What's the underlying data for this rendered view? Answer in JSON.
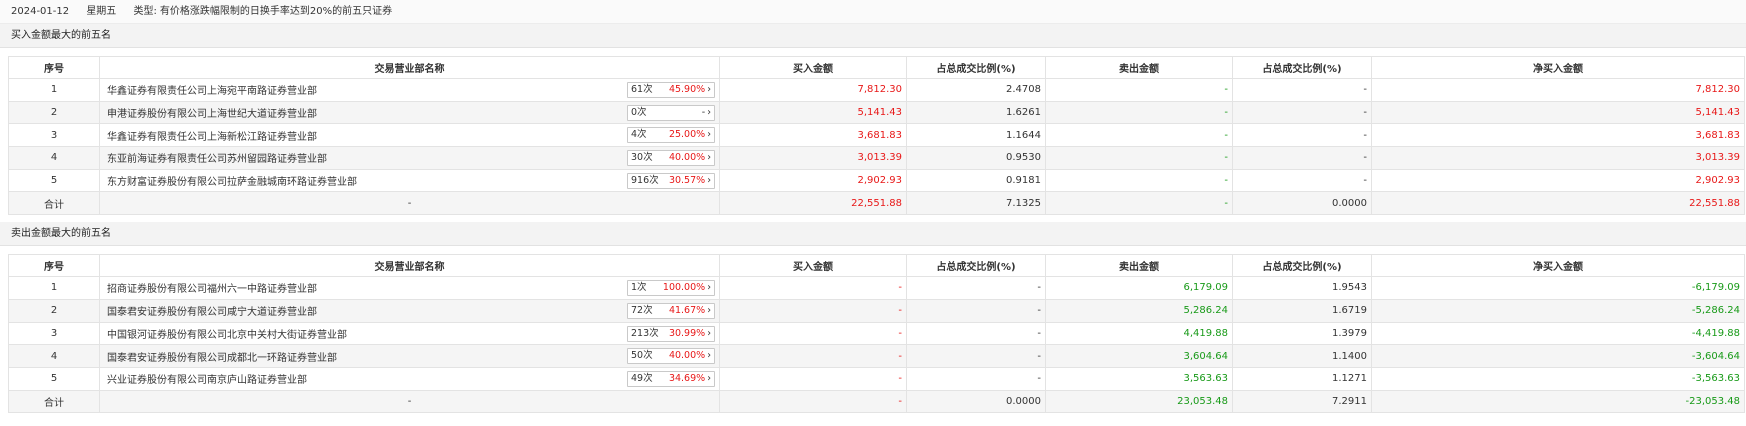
{
  "header": {
    "date": "2024-01-12",
    "weekday": "星期五",
    "type_label": "类型:",
    "type_value": "有价格涨跌幅限制的日换手率达到20%的前五只证券"
  },
  "columns": [
    "序号",
    "交易营业部名称",
    "买入金额",
    "占总成交比例(%)",
    "卖出金额",
    "占总成交比例(%)",
    "净买入金额"
  ],
  "buy_section": {
    "title": "买入金额最大的前五名",
    "rows": [
      {
        "idx": "1",
        "name": "华鑫证券有限责任公司上海宛平南路证券营业部",
        "count": "61次",
        "pct": "45.90%",
        "buy": "7,812.30",
        "buy_ratio": "2.4708",
        "sell": "-",
        "sell_ratio": "-",
        "net": "7,812.30"
      },
      {
        "idx": "2",
        "name": "申港证券股份有限公司上海世纪大道证券营业部",
        "count": "0次",
        "pct": "-",
        "buy": "5,141.43",
        "buy_ratio": "1.6261",
        "sell": "-",
        "sell_ratio": "-",
        "net": "5,141.43"
      },
      {
        "idx": "3",
        "name": "华鑫证券有限责任公司上海新松江路证券营业部",
        "count": "4次",
        "pct": "25.00%",
        "buy": "3,681.83",
        "buy_ratio": "1.1644",
        "sell": "-",
        "sell_ratio": "-",
        "net": "3,681.83"
      },
      {
        "idx": "4",
        "name": "东亚前海证券有限责任公司苏州留园路证券营业部",
        "count": "30次",
        "pct": "40.00%",
        "buy": "3,013.39",
        "buy_ratio": "0.9530",
        "sell": "-",
        "sell_ratio": "-",
        "net": "3,013.39"
      },
      {
        "idx": "5",
        "name": "东方财富证券股份有限公司拉萨金融城南环路证券营业部",
        "count": "916次",
        "pct": "30.57%",
        "buy": "2,902.93",
        "buy_ratio": "0.9181",
        "sell": "-",
        "sell_ratio": "-",
        "net": "2,902.93"
      }
    ],
    "total": {
      "label": "合计",
      "name": "-",
      "buy": "22,551.88",
      "buy_ratio": "7.1325",
      "sell": "-",
      "sell_ratio": "0.0000",
      "net": "22,551.88"
    }
  },
  "sell_section": {
    "title": "卖出金额最大的前五名",
    "rows": [
      {
        "idx": "1",
        "name": "招商证券股份有限公司福州六一中路证券营业部",
        "count": "1次",
        "pct": "100.00%",
        "buy": "-",
        "buy_ratio": "-",
        "sell": "6,179.09",
        "sell_ratio": "1.9543",
        "net": "-6,179.09"
      },
      {
        "idx": "2",
        "name": "国泰君安证券股份有限公司咸宁大道证券营业部",
        "count": "72次",
        "pct": "41.67%",
        "buy": "-",
        "buy_ratio": "-",
        "sell": "5,286.24",
        "sell_ratio": "1.6719",
        "net": "-5,286.24"
      },
      {
        "idx": "3",
        "name": "中国银河证券股份有限公司北京中关村大街证券营业部",
        "count": "213次",
        "pct": "30.99%",
        "buy": "-",
        "buy_ratio": "-",
        "sell": "4,419.88",
        "sell_ratio": "1.3979",
        "net": "-4,419.88"
      },
      {
        "idx": "4",
        "name": "国泰君安证券股份有限公司成都北一环路证券营业部",
        "count": "50次",
        "pct": "40.00%",
        "buy": "-",
        "buy_ratio": "-",
        "sell": "3,604.64",
        "sell_ratio": "1.1400",
        "net": "-3,604.64"
      },
      {
        "idx": "5",
        "name": "兴业证券股份有限公司南京庐山路证券营业部",
        "count": "49次",
        "pct": "34.69%",
        "buy": "-",
        "buy_ratio": "-",
        "sell": "3,563.63",
        "sell_ratio": "1.1271",
        "net": "-3,563.63"
      }
    ],
    "total": {
      "label": "合计",
      "name": "-",
      "buy": "-",
      "buy_ratio": "0.0000",
      "sell": "23,053.48",
      "sell_ratio": "7.2911",
      "net": "-23,053.48"
    }
  },
  "arrow_glyph": "›",
  "colors": {
    "up": "#e81818",
    "down": "#189a18"
  }
}
